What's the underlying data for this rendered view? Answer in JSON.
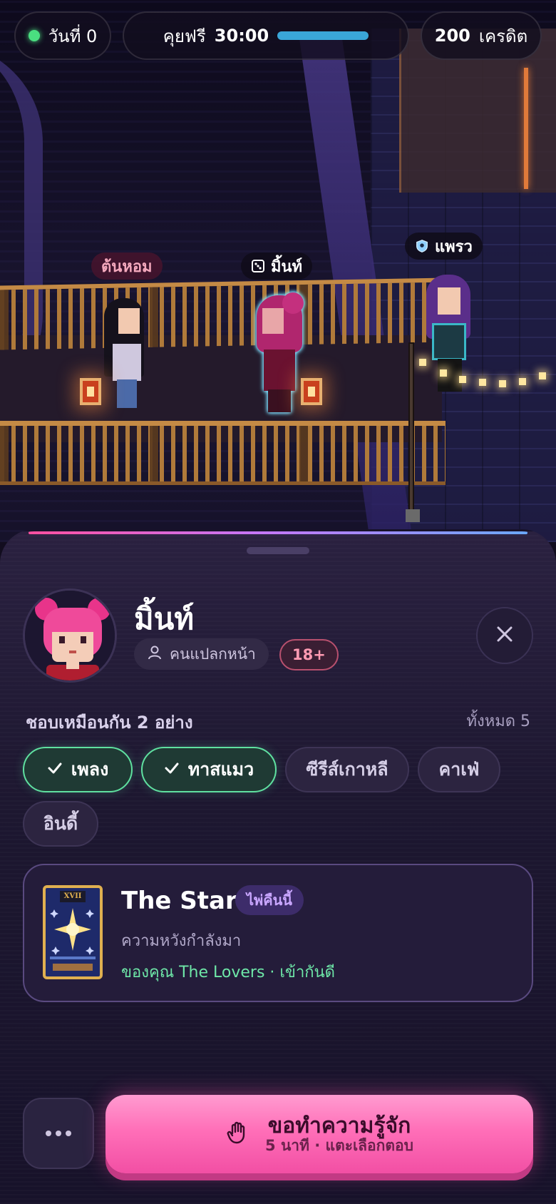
{
  "hud": {
    "day_label": "วันที่ 0",
    "chat_label": "คุยฟรี",
    "chat_timer": "30:00",
    "chat_timer_progress": 1.0,
    "credits_value": "200",
    "credits_label": "เครดิต"
  },
  "scene": {
    "characters": [
      {
        "name": "ต้นหอม",
        "tag_style": "pink",
        "icon": "none"
      },
      {
        "name": "มิ้นท์",
        "tag_style": "dark",
        "icon": "dice-icon"
      },
      {
        "name": "แพรว",
        "tag_style": "dark",
        "icon": "shield-icon"
      }
    ]
  },
  "profile": {
    "name": "มิ้นท์",
    "relationship": "คนแปลกหน้า",
    "age_badge": "18+"
  },
  "interests": {
    "title": "ชอบเหมือนกัน 2 อย่าง",
    "total": "ทั้งหมด 5",
    "items": [
      {
        "label": "เพลง",
        "matched": true
      },
      {
        "label": "ทาสแมว",
        "matched": true
      },
      {
        "label": "ซีรีส์เกาหลี",
        "matched": false
      },
      {
        "label": "คาเฟ่",
        "matched": false
      },
      {
        "label": "อินดี้",
        "matched": false
      }
    ]
  },
  "tarot": {
    "card_numeral": "XVII",
    "title": "The Star",
    "badge": "ไพ่คืนนี้",
    "meaning": "ความหวังกำลังมา",
    "compatibility": "ของคุณ The Lovers · เข้ากันดี"
  },
  "actions": {
    "cta_main": "ขอทำความรู้จัก",
    "cta_sub": "5 นาที · แตะเลือกตอบ"
  },
  "colors": {
    "accent_pink": "#ff6fb8",
    "match_green": "#5fe0a0",
    "timer_blue": "#3aa6d8"
  }
}
